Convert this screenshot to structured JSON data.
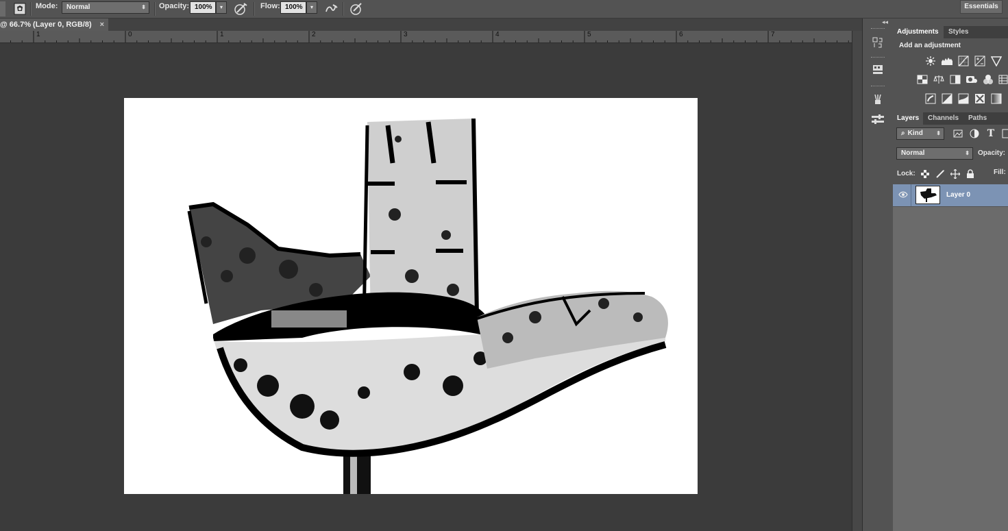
{
  "options_bar": {
    "mode_label": "Mode:",
    "mode_value": "Normal",
    "opacity_label": "Opacity:",
    "opacity_value": "100%",
    "flow_label": "Flow:",
    "flow_value": "100%",
    "workspace": "Essentials"
  },
  "document_tab": {
    "title": "@ 66.7% (Layer 0, RGB/8)",
    "close": "×"
  },
  "ruler": {
    "labels": [
      "1",
      "0",
      "1",
      "2",
      "3",
      "4",
      "5",
      "6",
      "7"
    ]
  },
  "adjustments_panel": {
    "tabs": [
      "Adjustments",
      "Styles"
    ],
    "heading": "Add an adjustment"
  },
  "layers_panel": {
    "tabs": [
      "Layers",
      "Channels",
      "Paths"
    ],
    "filter_kind": "Kind",
    "blend_mode": "Normal",
    "opacity_label": "Opacity:",
    "lock_label": "Lock:",
    "fill_label": "Fill:",
    "layers": [
      {
        "name": "Layer 0",
        "visible": true,
        "selected": true
      }
    ]
  },
  "colors": {
    "selected_layer": "#7c93b4",
    "canvas_bg": "#3b3b3b",
    "panel_bg": "#535353"
  }
}
